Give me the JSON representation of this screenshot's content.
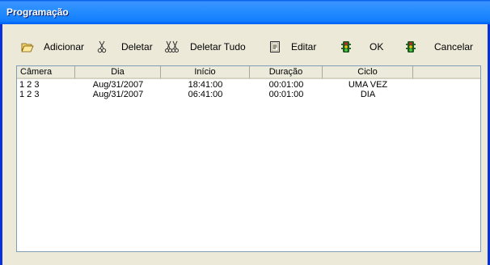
{
  "window": {
    "title": "Programação"
  },
  "toolbar": {
    "add_label": "Adicionar",
    "delete_label": "Deletar",
    "delete_all_label": "Deletar Tudo",
    "edit_label": "Editar",
    "ok_label": "OK",
    "cancel_label": "Cancelar",
    "icons": [
      "open-folder-icon",
      "scissors-icon",
      "double-scissors-icon",
      "document-icon",
      "traffic-light-icon",
      "traffic-light-icon"
    ]
  },
  "table": {
    "columns": [
      "Câmera",
      "Dia",
      "Início",
      "Duração",
      "Ciclo"
    ],
    "rows": [
      [
        "1 2 3",
        "Aug/31/2007",
        "18:41:00",
        "00:01:00",
        "UMA VEZ"
      ],
      [
        "1 2 3",
        "Aug/31/2007",
        "06:41:00",
        "00:01:00",
        "DIA"
      ]
    ]
  },
  "colors": {
    "titlebar": "#0058e6",
    "window_bg": "#ece9d8",
    "frame": "#0831d9"
  }
}
